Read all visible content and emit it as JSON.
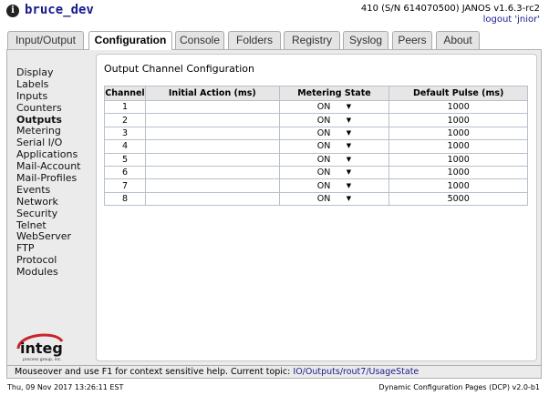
{
  "header": {
    "host": "bruce_dev",
    "version": "410 (S/N 614070500) JANOS v1.6.3-rc2",
    "logout": "logout 'jnior'"
  },
  "tabs": [
    {
      "label": "Input/Output"
    },
    {
      "label": "Configuration",
      "active": true
    },
    {
      "label": "Console"
    },
    {
      "label": "Folders"
    },
    {
      "label": "Registry"
    },
    {
      "label": "Syslog"
    },
    {
      "label": "Peers"
    },
    {
      "label": "About"
    }
  ],
  "sidebar": {
    "items": [
      {
        "label": "Display"
      },
      {
        "label": "Labels"
      },
      {
        "label": "Inputs"
      },
      {
        "label": "Counters"
      },
      {
        "label": "Outputs",
        "active": true
      },
      {
        "label": "Metering"
      },
      {
        "label": "Serial I/O"
      },
      {
        "label": "Applications"
      },
      {
        "label": "Mail-Account"
      },
      {
        "label": "Mail-Profiles"
      },
      {
        "label": "Events"
      },
      {
        "label": "Network"
      },
      {
        "label": "Security"
      },
      {
        "label": "Telnet"
      },
      {
        "label": "WebServer"
      },
      {
        "label": "FTP"
      },
      {
        "label": "Protocol"
      },
      {
        "label": "Modules"
      }
    ]
  },
  "logo": {
    "name": "integ",
    "tagline": "process group, inc."
  },
  "content": {
    "title": "Output Channel Configuration",
    "columns": [
      "Channel",
      "Initial Action (ms)",
      "Metering State",
      "Default Pulse (ms)"
    ],
    "rows": [
      {
        "channel": "1",
        "initial_action": "",
        "metering": "ON",
        "pulse": "1000"
      },
      {
        "channel": "2",
        "initial_action": "",
        "metering": "ON",
        "pulse": "1000"
      },
      {
        "channel": "3",
        "initial_action": "",
        "metering": "ON",
        "pulse": "1000"
      },
      {
        "channel": "4",
        "initial_action": "",
        "metering": "ON",
        "pulse": "1000"
      },
      {
        "channel": "5",
        "initial_action": "",
        "metering": "ON",
        "pulse": "1000"
      },
      {
        "channel": "6",
        "initial_action": "",
        "metering": "ON",
        "pulse": "1000"
      },
      {
        "channel": "7",
        "initial_action": "",
        "metering": "ON",
        "pulse": "1000"
      },
      {
        "channel": "8",
        "initial_action": "",
        "metering": "ON",
        "pulse": "5000"
      }
    ]
  },
  "help": {
    "text": "Mouseover and use F1 for context sensitive help. Current topic:",
    "topic": "IO/Outputs/rout7/UsageState"
  },
  "status": {
    "datetime": "Thu, 09 Nov 2017 13:26:11 EST",
    "app": "Dynamic Configuration Pages (DCP) v2.0-b1"
  },
  "colors": {
    "link": "#1a1a8c",
    "panel_bg": "#ebebeb",
    "logo_red": "#c8252b"
  },
  "icons": {
    "info": "info-icon",
    "dropdown": "chevron-down-icon"
  }
}
